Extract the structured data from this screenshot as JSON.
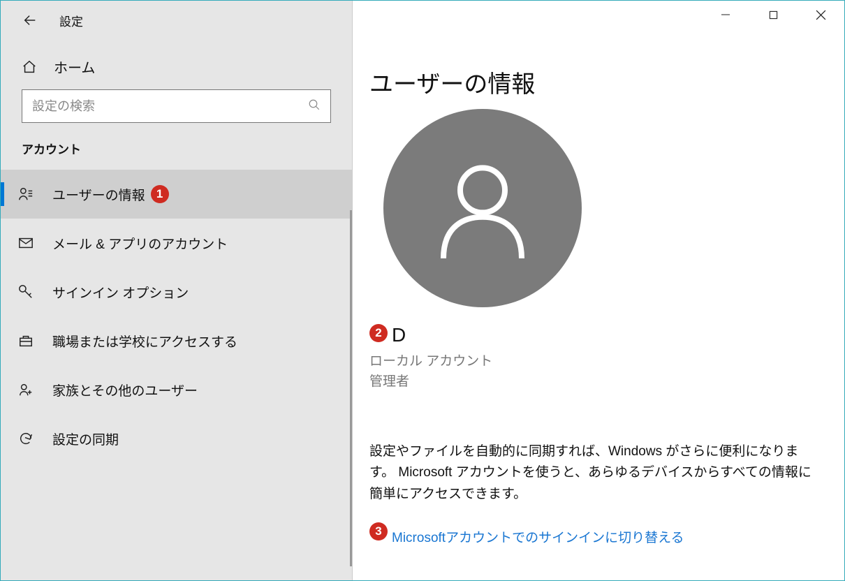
{
  "app": {
    "title": "設定"
  },
  "sidebar": {
    "home_label": "ホーム",
    "search_placeholder": "設定の検索",
    "section_label": "アカウント",
    "items": [
      {
        "label": "ユーザーの情報",
        "selected": true,
        "badge": "1"
      },
      {
        "label": "メール & アプリのアカウント"
      },
      {
        "label": "サインイン オプション"
      },
      {
        "label": "職場または学校にアクセスする"
      },
      {
        "label": "家族とその他のユーザー"
      },
      {
        "label": "設定の同期"
      }
    ]
  },
  "main": {
    "page_title": "ユーザーの情報",
    "user_name": "D",
    "user_name_badge": "2",
    "account_type": "ローカル アカウント",
    "role": "管理者",
    "sync_description": "設定やファイルを自動的に同期すれば、Windows がさらに便利になります。 Microsoft アカウントを使うと、あらゆるデバイスからすべての情報に簡単にアクセスできます。",
    "ms_link_badge": "3",
    "ms_link_text": "Microsoftアカウントでのサインインに切り替える"
  }
}
